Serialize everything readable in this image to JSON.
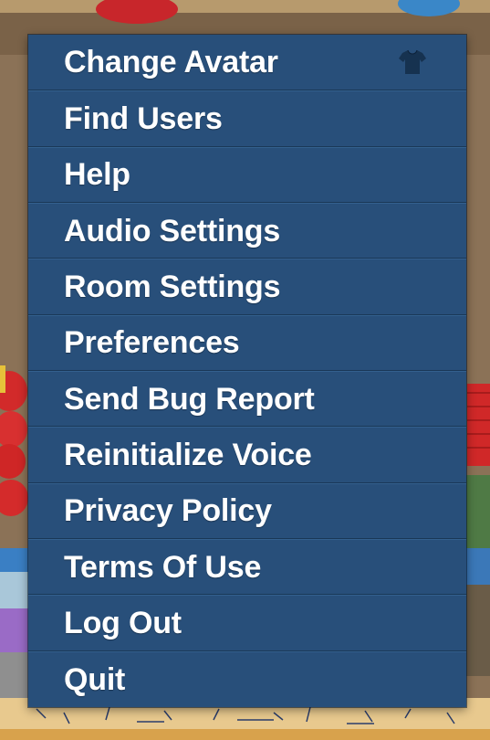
{
  "menu": {
    "items": [
      {
        "label": "Change Avatar",
        "icon": "shirt-icon"
      },
      {
        "label": "Find Users"
      },
      {
        "label": "Help"
      },
      {
        "label": "Audio Settings"
      },
      {
        "label": "Room Settings"
      },
      {
        "label": "Preferences"
      },
      {
        "label": "Send Bug Report"
      },
      {
        "label": "Reinitialize Voice"
      },
      {
        "label": "Privacy Policy"
      },
      {
        "label": "Terms Of Use"
      },
      {
        "label": "Log Out"
      },
      {
        "label": "Quit"
      }
    ]
  },
  "colors": {
    "menu_background": "#284f7a",
    "menu_divider": "#1a3857",
    "menu_text": "#ffffff"
  }
}
